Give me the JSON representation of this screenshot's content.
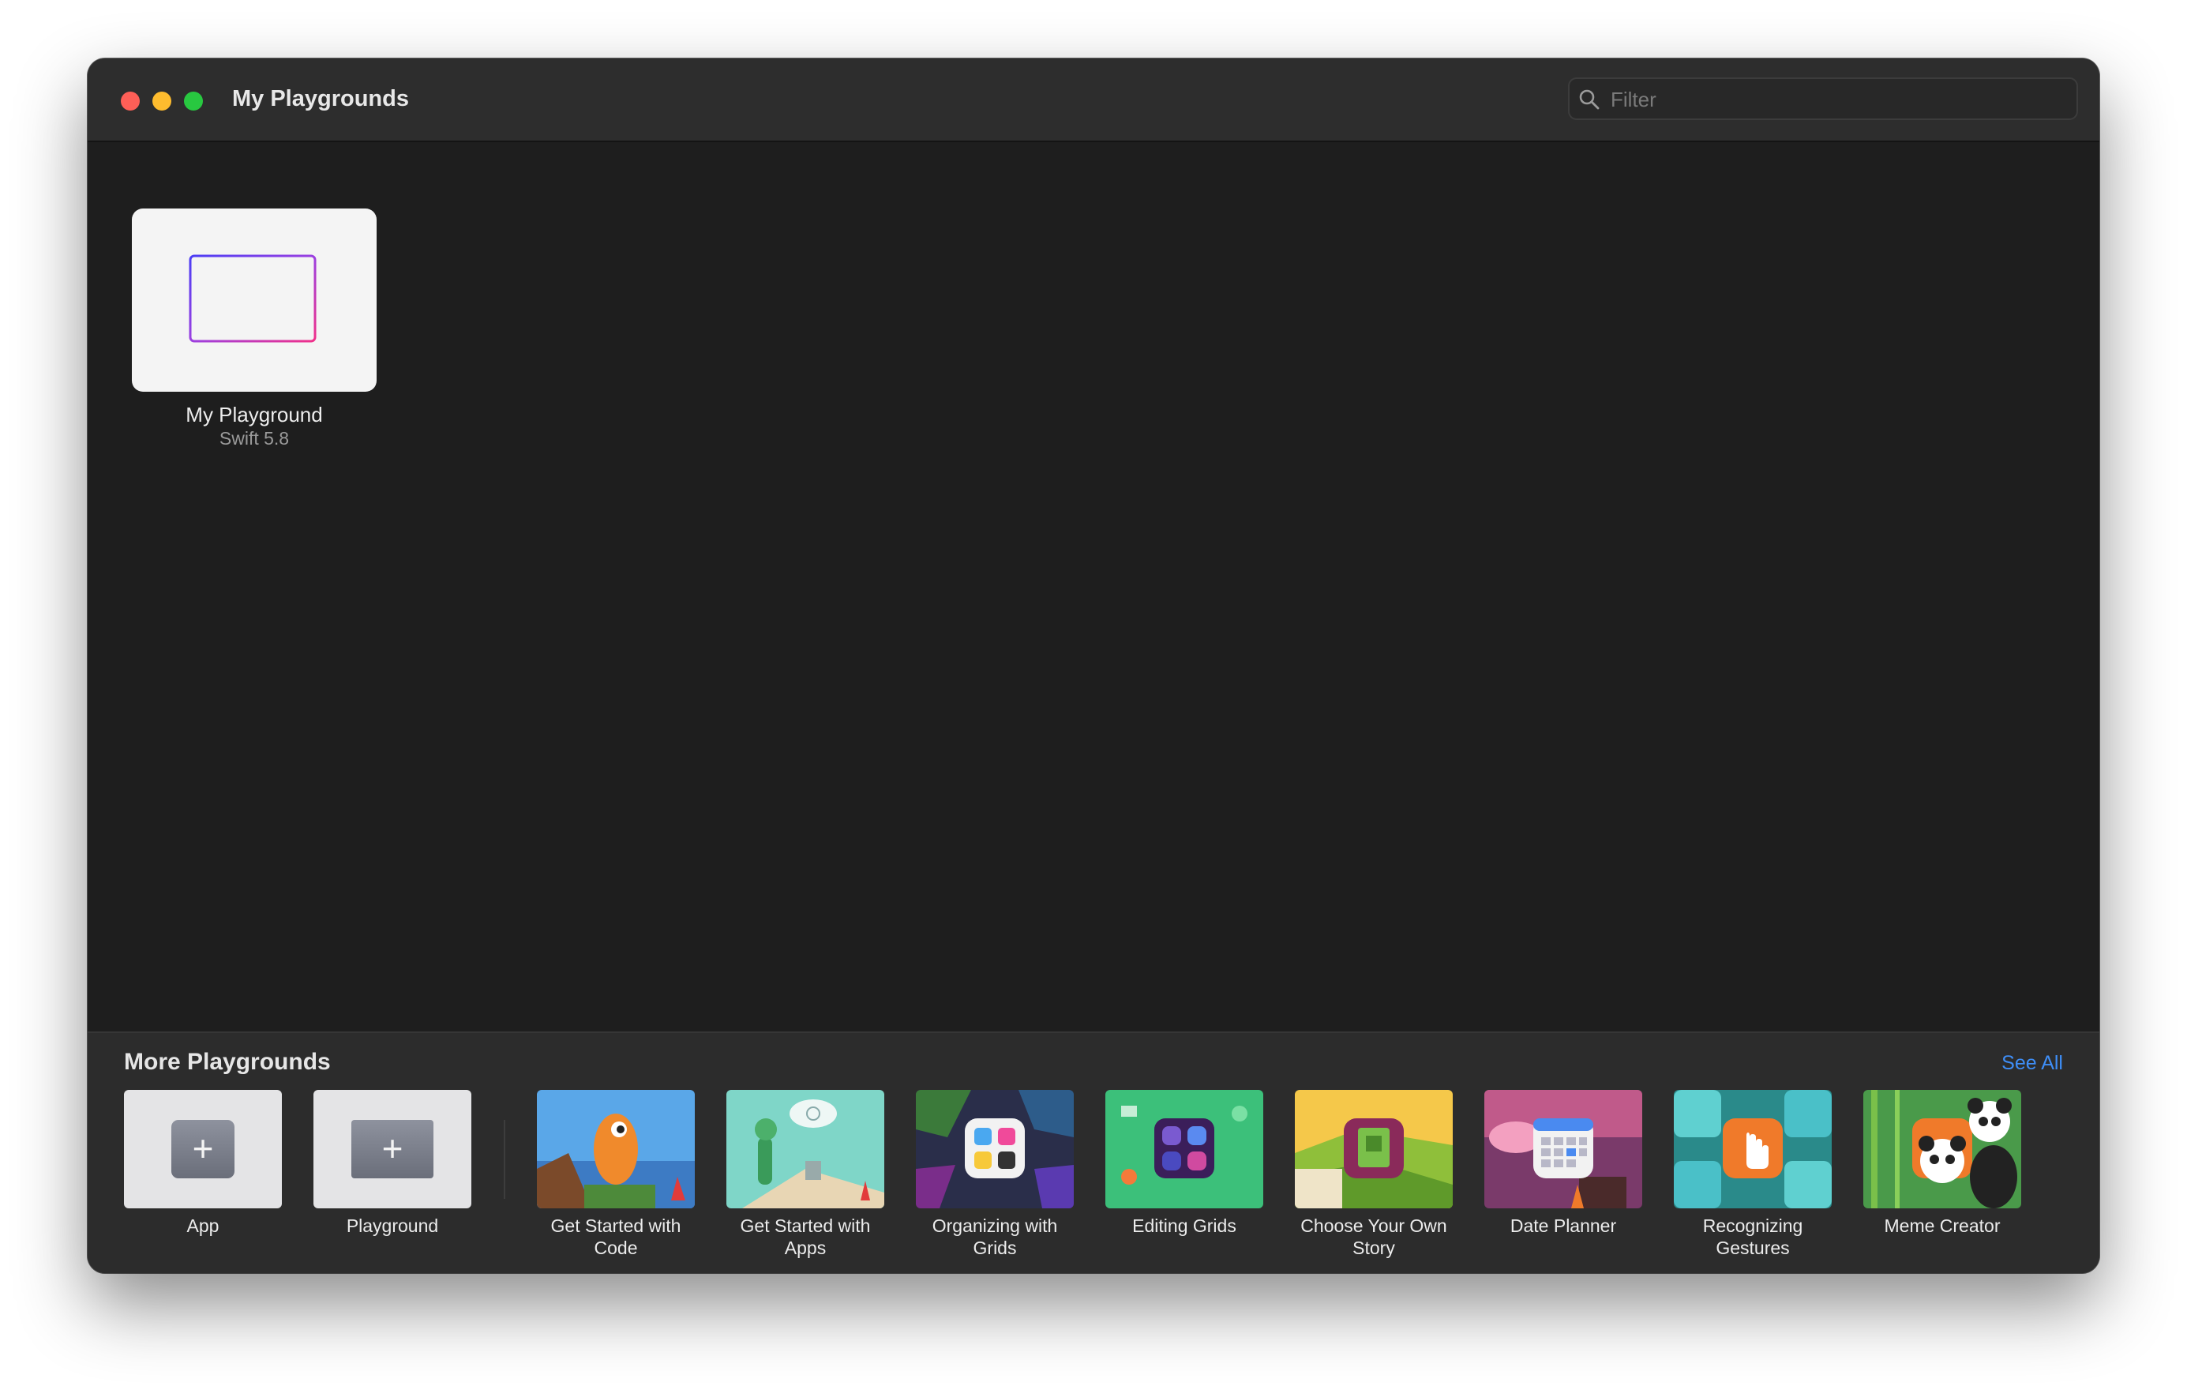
{
  "window": {
    "title": "My Playgrounds"
  },
  "filter": {
    "placeholder": "Filter"
  },
  "playgrounds": [
    {
      "name": "My Playground",
      "subtitle": "Swift 5.8"
    }
  ],
  "more": {
    "title": "More Playgrounds",
    "see_all": "See All",
    "templates": [
      {
        "label": "App",
        "icon": "plus-icon"
      },
      {
        "label": "Playground",
        "icon": "plus-icon"
      }
    ],
    "items": [
      {
        "line1": "Get Started with",
        "line2": "Code"
      },
      {
        "line1": "Get Started with",
        "line2": "Apps"
      },
      {
        "line1": "Organizing with",
        "line2": "Grids"
      },
      {
        "line1": "Editing Grids",
        "line2": ""
      },
      {
        "line1": "Choose Your Own",
        "line2": "Story"
      },
      {
        "line1": "Date Planner",
        "line2": ""
      },
      {
        "line1": "Recognizing",
        "line2": "Gestures"
      },
      {
        "line1": "Meme Creator",
        "line2": ""
      }
    ]
  },
  "colors": {
    "close": "#fe5f57",
    "minimize": "#febc2e",
    "zoom": "#28c840",
    "link": "#3e8ef7",
    "background": "#1e1e1e"
  }
}
